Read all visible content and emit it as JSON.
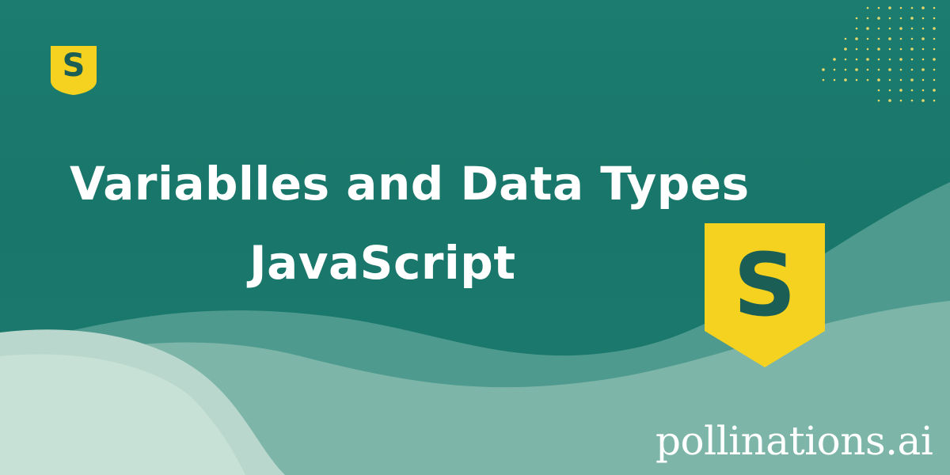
{
  "banner": {
    "title_line_1": "Variablles and Data Types",
    "title_line_2": "JavaScript"
  },
  "logos": {
    "small_letter": "S",
    "large_letter": "S",
    "shape": "shield-icon"
  },
  "watermark": {
    "text": "pollinations.ai"
  },
  "colors": {
    "background": "#1a7a6d",
    "wave_dark": "#5fa59a",
    "wave_mid": "#8bbfb3",
    "wave_light": "#c4ddd3",
    "logo_yellow": "#f4d21f",
    "logo_letter": "#1b5e55",
    "dot_color": "#e8d96a",
    "text": "#ffffff"
  }
}
